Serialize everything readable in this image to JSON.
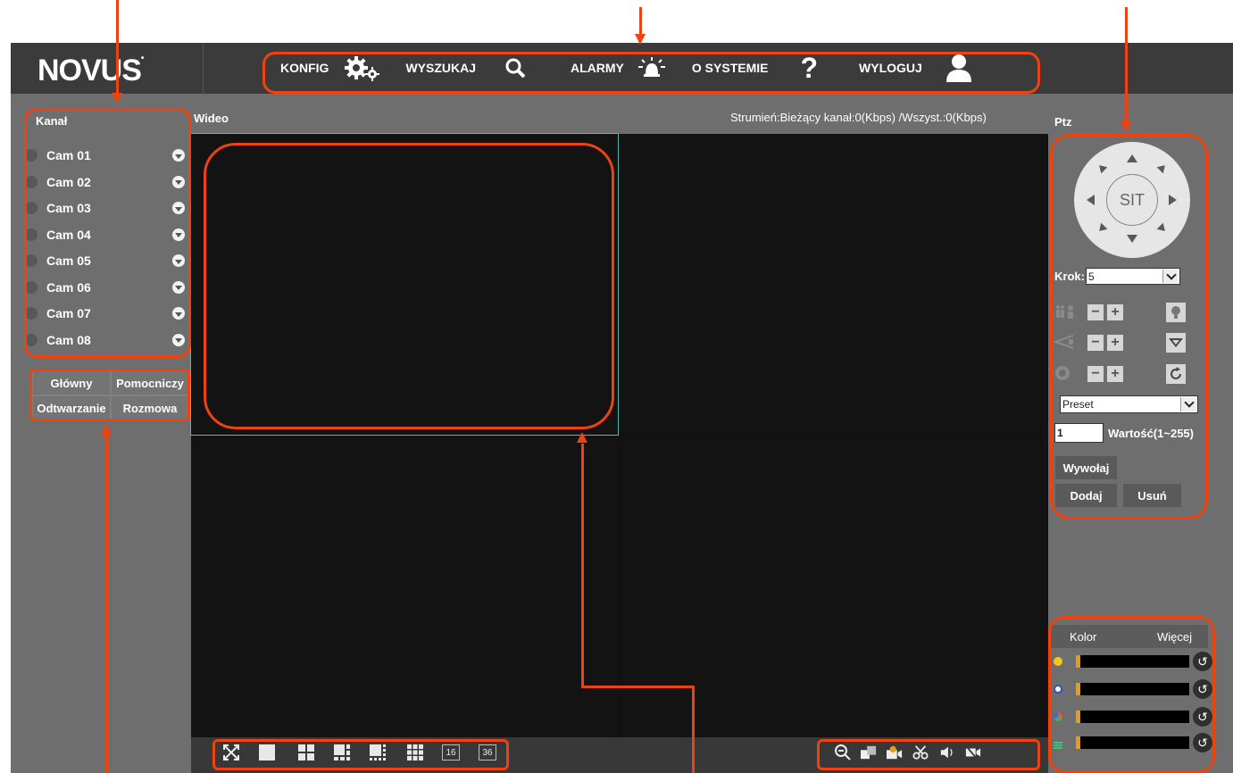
{
  "header": {
    "logo_text": "NOVUS",
    "menu": [
      {
        "label": "KONFIG",
        "icon": "gears-icon"
      },
      {
        "label": "WYSZUKAJ",
        "icon": "search-icon"
      },
      {
        "label": "ALARMY",
        "icon": "alarm-siren-icon"
      },
      {
        "label": "O SYSTEMIE",
        "icon": "question-mark-icon"
      },
      {
        "label": "WYLOGUJ",
        "icon": "user-icon"
      }
    ]
  },
  "sidebar": {
    "title": "Kanał",
    "cameras": [
      "Cam 01",
      "Cam 02",
      "Cam 03",
      "Cam 04",
      "Cam 05",
      "Cam 06",
      "Cam 07",
      "Cam 08"
    ],
    "stream_buttons": [
      "Główny",
      "Pomocniczy",
      "Odtwarzanie",
      "Rozmowa"
    ]
  },
  "video": {
    "title": "Wideo",
    "stream_info": "Strumień:Bieżący kanał:0(Kbps) /Wszyst.:0(Kbps)",
    "layout_numbers": [
      "16",
      "36"
    ]
  },
  "ptz": {
    "title": "Ptz",
    "center_label": "SIT",
    "step_label": "Krok:",
    "step_value": "5",
    "preset_select": "Preset",
    "value_input": "1",
    "value_label": "Wartość(1~255)",
    "call_button": "Wywołaj",
    "add_button": "Dodaj",
    "delete_button": "Usuń"
  },
  "image": {
    "tabs": [
      "Kolor",
      "Więcej"
    ]
  },
  "colors": {
    "annotation": "#ee4211",
    "header_bg": "#3b3b3b",
    "panel_bg": "#6e6e6e",
    "slider_knob": "#e79a1c"
  }
}
